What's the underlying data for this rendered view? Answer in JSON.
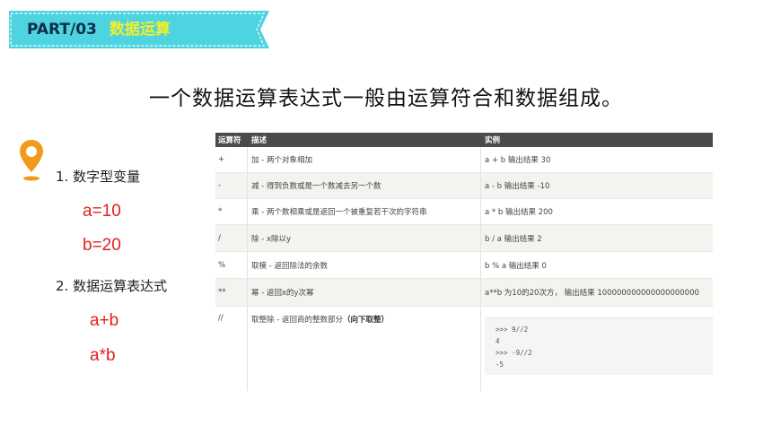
{
  "header": {
    "part_label": "PART/03",
    "part_title": "数据运算",
    "colors": {
      "banner_bg": "#4ed3e0",
      "part_label": "#0f2d4a",
      "part_title": "#f2ef2a"
    }
  },
  "headline": "一个数据运算表达式一般由运算符合和数据组成。",
  "left": {
    "pin_icon": "location-pin-icon",
    "pin_color": "#f29a1b",
    "item1": "1. 数字型变量",
    "item1_values": [
      "a=10",
      "b=20"
    ],
    "item2": "2. 数据运算表达式",
    "item2_values": [
      "a+b",
      "a*b"
    ]
  },
  "table": {
    "headers": [
      "运算符",
      "描述",
      "实例"
    ],
    "rows": [
      {
        "op": "+",
        "desc": "加 - 两个对象相加",
        "example": "a + b 输出结果 30"
      },
      {
        "op": "-",
        "desc": "减 - 得到负数或是一个数减去另一个数",
        "example": "a - b 输出结果 -10"
      },
      {
        "op": "*",
        "desc": "乘 - 两个数相乘或是返回一个被重复若干次的字符串",
        "example": "a * b 输出结果 200"
      },
      {
        "op": "/",
        "desc": "除 - x除以y",
        "example": "b / a 输出结果 2"
      },
      {
        "op": "%",
        "desc": "取模 - 返回除法的余数",
        "example": "b % a 输出结果 0"
      },
      {
        "op": "**",
        "desc": "幂 - 返回x的y次幂",
        "example": "a**b 为10的20次方， 输出结果 100000000000000000000"
      },
      {
        "op": "//",
        "desc": "取整除 - 返回商的整数部分",
        "desc_bold": "（向下取整）",
        "example": ""
      }
    ],
    "code_lines": [
      ">>> 9//2",
      "4",
      ">>> -9//2",
      "-5"
    ]
  }
}
